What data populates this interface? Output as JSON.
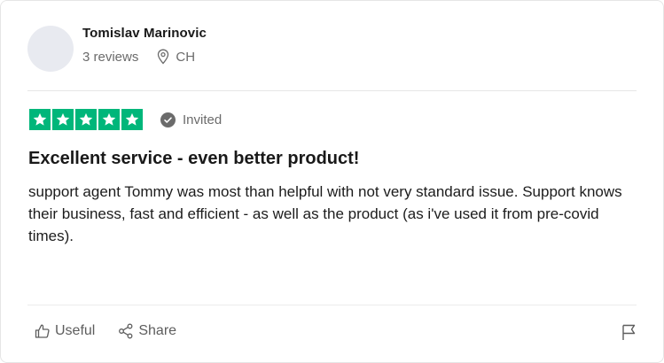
{
  "reviewer": {
    "name": "Tomislav Marinovic",
    "reviews_count": "3 reviews",
    "country": "CH"
  },
  "rating": {
    "stars": 5,
    "max": 5,
    "star_color": "#00b67a",
    "invited_label": "Invited"
  },
  "review": {
    "title": "Excellent service - even better product!",
    "body": "support agent Tommy was most than helpful with not very standard issue. Support knows their business, fast and efficient - as well as the product (as i've used it from pre-covid times)."
  },
  "actions": {
    "useful_label": "Useful",
    "share_label": "Share",
    "flag_icon": "flag-icon"
  }
}
